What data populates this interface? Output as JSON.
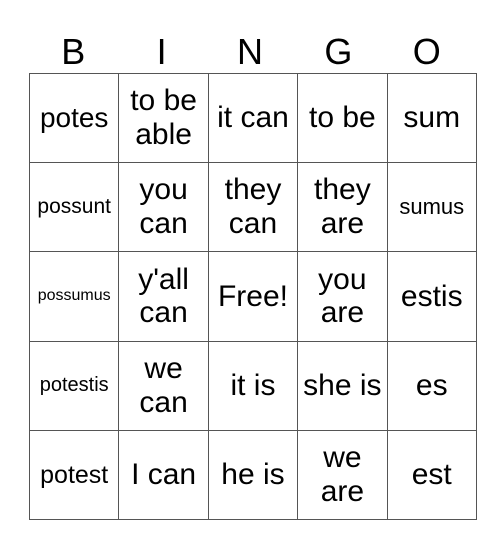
{
  "header": [
    "B",
    "I",
    "N",
    "G",
    "O"
  ],
  "rows": [
    [
      "potes",
      "to be able",
      "it can",
      "to be",
      "sum"
    ],
    [
      "possunt",
      "you can",
      "they can",
      "they are",
      "sumus"
    ],
    [
      "possumus",
      "y'all can",
      "Free!",
      "you are",
      "estis"
    ],
    [
      "potestis",
      "we can",
      "it is",
      "she is",
      "es"
    ],
    [
      "potest",
      "I can",
      "he is",
      "we are",
      "est"
    ]
  ]
}
